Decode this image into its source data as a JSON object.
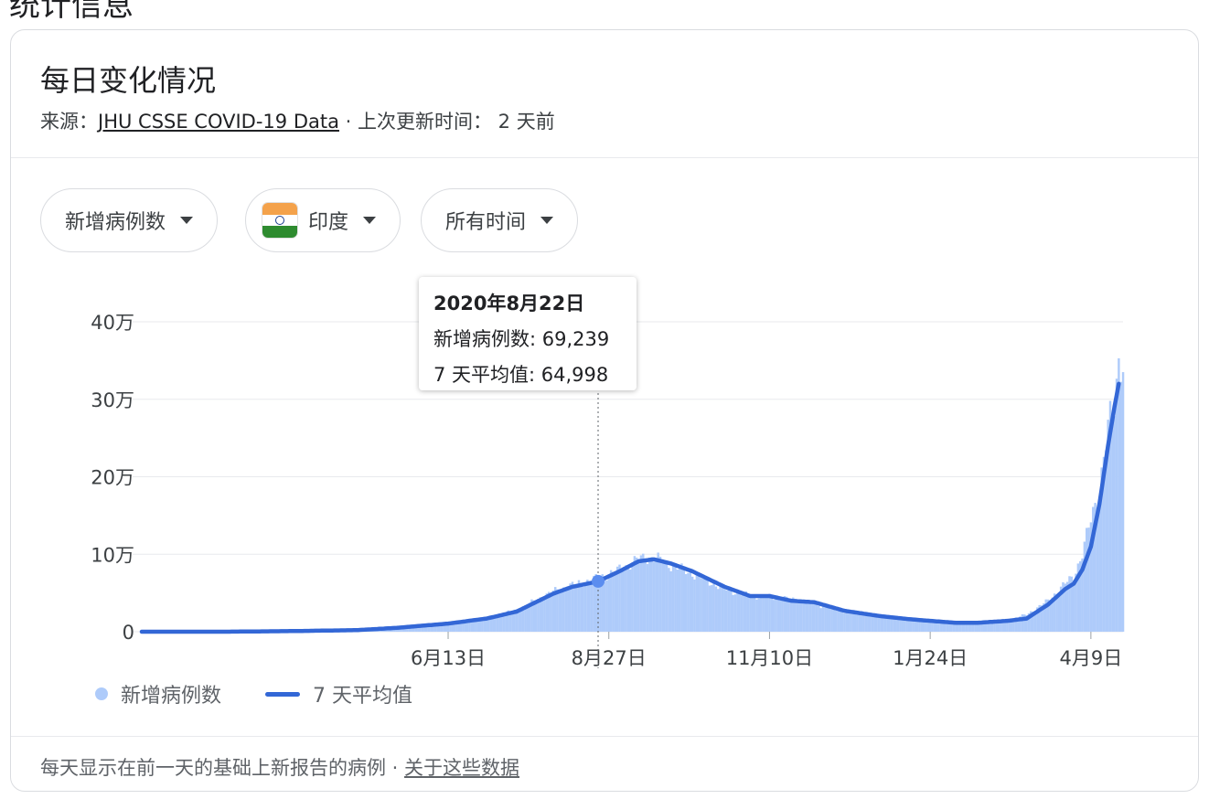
{
  "page": {
    "section_heading": "统计信息"
  },
  "card": {
    "title": "每日变化情况",
    "source_prefix": "来源：",
    "source_link": "JHU CSSE COVID-19 Data",
    "source_suffix": " · 上次更新时间： 2 天前"
  },
  "filters": {
    "metric": "新增病例数",
    "country": "印度",
    "range": "所有时间"
  },
  "tooltip": {
    "date": "2020年8月22日",
    "new_cases": "新增病例数: 69,239",
    "avg": "7 天平均值: 64,998"
  },
  "legend": {
    "bars": "新增病例数",
    "line": "7 天平均值"
  },
  "footer": {
    "note": "每天显示在前一天的基础上新报告的病例",
    "separator": " · ",
    "link": "关于这些数据"
  },
  "colors": {
    "bar": "#aecbfa",
    "line": "#3367d6",
    "grid": "#e8eaed",
    "dot": "#5b8def"
  },
  "chart_data": {
    "type": "bar",
    "y_ticks": [
      "0",
      "10万",
      "20万",
      "30万",
      "40万"
    ],
    "y_tick_values": [
      0,
      100000,
      200000,
      300000,
      400000
    ],
    "ylim": [
      0,
      400000
    ],
    "x_ticks": [
      "6月13日",
      "8月27日",
      "11月10日",
      "1月24日",
      "4月9日"
    ],
    "x_tick_values": [
      "2020-06-13",
      "2020-08-27",
      "2020-11-10",
      "2021-01-24",
      "2021-04-09"
    ],
    "xlim": [
      "2020-01-22",
      "2021-04-24"
    ],
    "highlight": {
      "date": "2020-08-22",
      "value": 64998
    },
    "series": [
      {
        "name": "7 天平均值",
        "type": "line",
        "points": [
          [
            "2020-01-22",
            0
          ],
          [
            "2020-03-01",
            0
          ],
          [
            "2020-04-01",
            800
          ],
          [
            "2020-05-01",
            2000
          ],
          [
            "2020-05-20",
            5000
          ],
          [
            "2020-06-13",
            10500
          ],
          [
            "2020-07-01",
            17000
          ],
          [
            "2020-07-15",
            26000
          ],
          [
            "2020-08-01",
            49000
          ],
          [
            "2020-08-10",
            58000
          ],
          [
            "2020-08-22",
            64998
          ],
          [
            "2020-09-01",
            78000
          ],
          [
            "2020-09-10",
            91000
          ],
          [
            "2020-09-17",
            93500
          ],
          [
            "2020-09-25",
            88000
          ],
          [
            "2020-10-05",
            78000
          ],
          [
            "2020-10-20",
            58000
          ],
          [
            "2020-11-01",
            46000
          ],
          [
            "2020-11-10",
            46000
          ],
          [
            "2020-11-20",
            40000
          ],
          [
            "2020-12-01",
            38000
          ],
          [
            "2020-12-15",
            27000
          ],
          [
            "2021-01-01",
            20000
          ],
          [
            "2021-01-15",
            16000
          ],
          [
            "2021-01-24",
            14000
          ],
          [
            "2021-02-05",
            11500
          ],
          [
            "2021-02-15",
            11500
          ],
          [
            "2021-03-01",
            14000
          ],
          [
            "2021-03-10",
            17000
          ],
          [
            "2021-03-20",
            35000
          ],
          [
            "2021-03-28",
            55000
          ],
          [
            "2021-04-01",
            62000
          ],
          [
            "2021-04-05",
            80000
          ],
          [
            "2021-04-09",
            110000
          ],
          [
            "2021-04-13",
            165000
          ],
          [
            "2021-04-17",
            240000
          ],
          [
            "2021-04-20",
            290000
          ],
          [
            "2021-04-22",
            320000
          ]
        ]
      },
      {
        "name": "新增病例数",
        "type": "bar",
        "points": [
          [
            "2020-01-22",
            0
          ],
          [
            "2020-03-01",
            0
          ],
          [
            "2020-04-01",
            900
          ],
          [
            "2020-05-01",
            2200
          ],
          [
            "2020-05-20",
            5500
          ],
          [
            "2020-06-13",
            11000
          ],
          [
            "2020-07-01",
            18000
          ],
          [
            "2020-07-15",
            28000
          ],
          [
            "2020-08-01",
            52000
          ],
          [
            "2020-08-10",
            60000
          ],
          [
            "2020-08-22",
            69239
          ],
          [
            "2020-09-01",
            80000
          ],
          [
            "2020-09-10",
            94000
          ],
          [
            "2020-09-17",
            96000
          ],
          [
            "2020-09-25",
            86000
          ],
          [
            "2020-10-05",
            75000
          ],
          [
            "2020-10-20",
            55000
          ],
          [
            "2020-11-01",
            46000
          ],
          [
            "2020-11-10",
            45000
          ],
          [
            "2020-11-20",
            42000
          ],
          [
            "2020-12-01",
            36000
          ],
          [
            "2020-12-15",
            26000
          ],
          [
            "2021-01-01",
            20000
          ],
          [
            "2021-01-15",
            15000
          ],
          [
            "2021-01-24",
            13000
          ],
          [
            "2021-02-05",
            11000
          ],
          [
            "2021-02-15",
            12000
          ],
          [
            "2021-03-01",
            15000
          ],
          [
            "2021-03-10",
            22000
          ],
          [
            "2021-03-20",
            40000
          ],
          [
            "2021-03-28",
            62000
          ],
          [
            "2021-04-01",
            72000
          ],
          [
            "2021-04-05",
            100000
          ],
          [
            "2021-04-09",
            145000
          ],
          [
            "2021-04-13",
            185000
          ],
          [
            "2021-04-17",
            261000
          ],
          [
            "2021-04-20",
            295000
          ],
          [
            "2021-04-22",
            352000
          ],
          [
            "2021-04-24",
            352000
          ]
        ]
      }
    ]
  }
}
